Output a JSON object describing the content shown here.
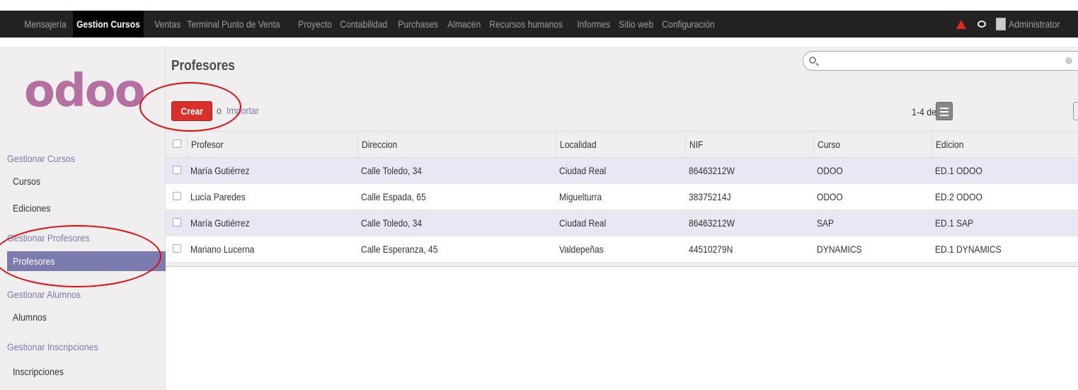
{
  "topbar": {
    "menu": [
      {
        "label": "Mensajería",
        "active": false
      },
      {
        "label": "Gestion Cursos",
        "active": true
      },
      {
        "label": "Ventas",
        "active": false
      },
      {
        "label": "Terminal Punto de Venta",
        "active": false
      },
      {
        "label": "Proyecto",
        "active": false
      },
      {
        "label": "Contabilidad",
        "active": false
      },
      {
        "label": "Purchases",
        "active": false
      },
      {
        "label": "Almacén",
        "active": false
      },
      {
        "label": "Recursos humanos",
        "active": false
      },
      {
        "label": "Informes",
        "active": false
      },
      {
        "label": "Sitio web",
        "active": false
      },
      {
        "label": "Configuración",
        "active": false
      }
    ],
    "user": "Administrator",
    "icons": [
      "warning-icon",
      "chat-icon",
      "avatar"
    ]
  },
  "sidebar": {
    "logo": "odoo",
    "sections": [
      {
        "header": "Gestionar Cursos",
        "items": [
          "Cursos",
          "Ediciones"
        ]
      },
      {
        "header": "Gestionar Profesores",
        "items": [
          "Profesores"
        ]
      },
      {
        "header": "Gestionar Alumnos",
        "items": [
          "Alumnos"
        ]
      },
      {
        "header": "Gestionar Inscripciones",
        "items": [
          "Inscripciones"
        ]
      }
    ],
    "active_item": "Profesores"
  },
  "main": {
    "title": "Profesores",
    "create_label": "Crear",
    "or_label": "o",
    "import_label": "Importar",
    "pager": "1-4 de 4",
    "search_placeholder": ""
  },
  "table": {
    "columns": [
      "Profesor",
      "Direccion",
      "Localidad",
      "NIF",
      "Curso",
      "Edicion"
    ],
    "rows": [
      [
        "María Gutiérrez",
        "Calle Toledo, 34",
        "Ciudad Real",
        "86463212W",
        "ODOO",
        "ED.1 ODOO"
      ],
      [
        "Lucía Paredes",
        "Calle Espada, 65",
        "Miguelturra",
        "38375214J",
        "ODOO",
        "ED.2 ODOO"
      ],
      [
        "María Gutiérrez",
        "Calle Toledo, 34",
        "Ciudad Real",
        "86463212W",
        "SAP",
        "ED.1 SAP"
      ],
      [
        "Mariano Lucerna",
        "Calle Esperanza, 45",
        "Valdepeñas",
        "44510279N",
        "DYNAMICS",
        "ED.1 DYNAMICS"
      ]
    ]
  },
  "colors": {
    "accent": "#7c7bad",
    "create_button": "#d9302b",
    "topbar": "#222222",
    "annotation": "#e30a0a"
  }
}
